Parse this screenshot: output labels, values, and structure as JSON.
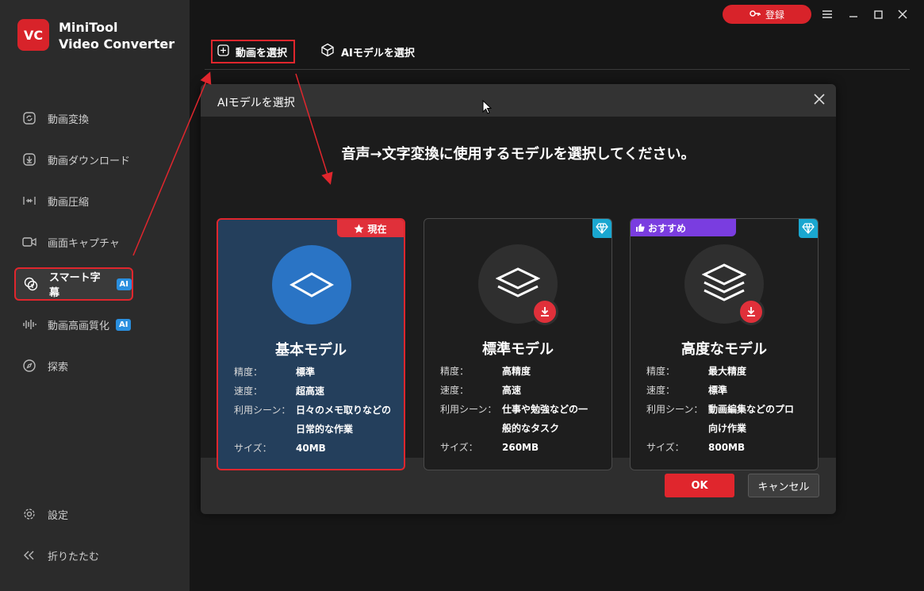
{
  "app": {
    "logo_text": "VC",
    "title_line1": "MiniTool",
    "title_line2": "Video Converter",
    "brand_color": "#d8232a"
  },
  "topbar": {
    "register_label": "登録",
    "register_icon": "key-icon",
    "menu_icon": "hamburger-icon",
    "minimize_icon": "minimize-icon",
    "maximize_icon": "maximize-icon",
    "close_icon": "close-icon"
  },
  "sidebar": {
    "items": [
      {
        "label": "動画変換",
        "icon": "convert-icon"
      },
      {
        "label": "動画ダウンロード",
        "icon": "download-icon"
      },
      {
        "label": "動画圧縮",
        "icon": "compress-icon"
      },
      {
        "label": "画面キャプチャ",
        "icon": "camera-icon"
      },
      {
        "label": "スマート字幕",
        "icon": "subtitle-icon",
        "badge": "AI",
        "active": true
      },
      {
        "label": "動画高画質化",
        "icon": "waveform-icon",
        "badge": "AI"
      },
      {
        "label": "探索",
        "icon": "compass-icon"
      }
    ],
    "settings_label": "設定",
    "collapse_label": "折りたたむ"
  },
  "tabs": {
    "select_video": "動画を選択",
    "select_ai_model": "AIモデルを選択"
  },
  "dialog": {
    "title": "AIモデルを選択",
    "heading": "音声→文字変換に使用するモデルを選択してください。",
    "ok_label": "OK",
    "cancel_label": "キャンセル",
    "spec_labels": {
      "accuracy": "精度：",
      "speed": "速度：",
      "scene": "利用シーン：",
      "size": "サイズ："
    },
    "models": [
      {
        "name": "基本モデル",
        "tag": "現在",
        "accuracy": "標準",
        "speed": "超高速",
        "scene_line1": "日々のメモ取りなどの",
        "scene_line2": "日常的な作業",
        "size": "40MB"
      },
      {
        "name": "標準モデル",
        "accuracy": "高精度",
        "speed": "高速",
        "scene_line1": "仕事や勉強などの一",
        "scene_line2": "般的なタスク",
        "size": "260MB"
      },
      {
        "name": "高度なモデル",
        "tag": "おすすめ",
        "accuracy": "最大精度",
        "speed": "標準",
        "scene_line1": "動画編集などのプロ",
        "scene_line2": "向け作業",
        "size": "800MB"
      }
    ]
  }
}
